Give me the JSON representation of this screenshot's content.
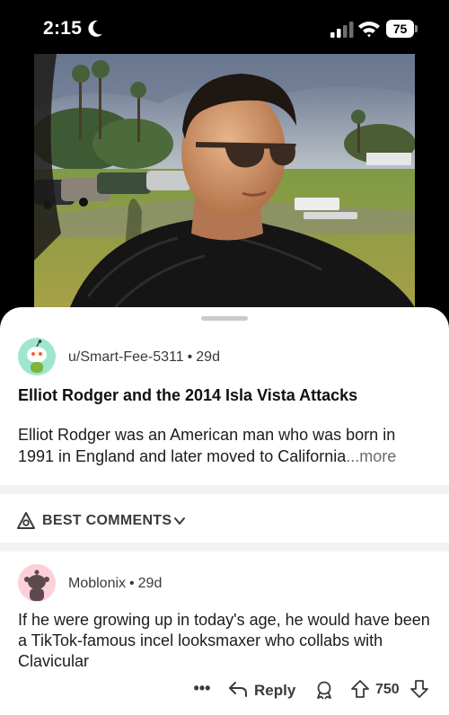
{
  "status_bar": {
    "time": "2:15",
    "battery": "75"
  },
  "post": {
    "author": "u/Smart-Fee-5311",
    "separator": "•",
    "age": "29d",
    "title": "Elliot Rodger and the 2014 Isla Vista Attacks",
    "body": "Elliot Rodger was an American man who was born in 1991 in England and later moved to California",
    "more_label": "...more"
  },
  "comments_header": {
    "sort_label": "BEST COMMENTS"
  },
  "comment": {
    "author": "Moblonix",
    "separator": "•",
    "age": "29d",
    "body": "If he were growing up in today's age, he would have been a TikTok-famous incel looksmaxer who collabs with Clavicular",
    "more_label": "•••",
    "reply_label": "Reply",
    "score": "750"
  },
  "colors": {
    "post_avatar_bg": "#9fe6cf",
    "comment_avatar_bg": "#fcd0d9",
    "divider": "#f2f2f5"
  },
  "icons": [
    "moon-icon",
    "cellular-signal-icon",
    "wifi-icon",
    "battery-icon",
    "snoo-avatar-icon",
    "best-sort-icon",
    "chevron-down-icon",
    "reply-icon",
    "award-icon",
    "upvote-icon",
    "downvote-icon"
  ]
}
